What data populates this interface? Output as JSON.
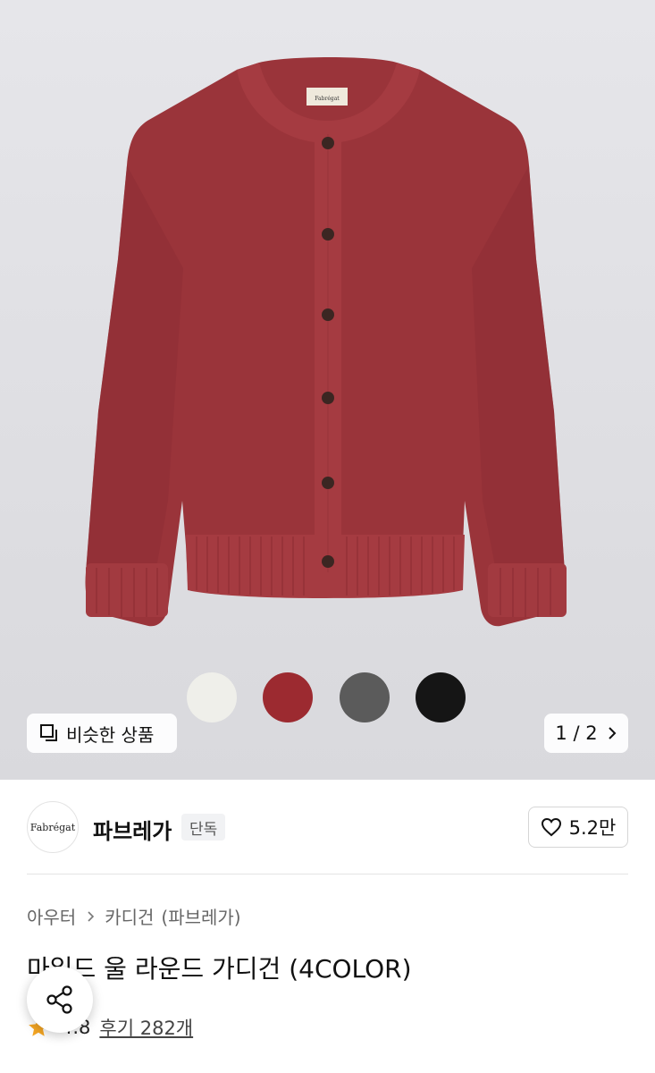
{
  "gallery": {
    "similar_label": "비슷한 상품",
    "page_indicator": "1 / 2",
    "swatches": [
      {
        "name": "cream",
        "color": "#efefea"
      },
      {
        "name": "red",
        "color": "#9c2a30"
      },
      {
        "name": "gray",
        "color": "#5b5b5b"
      },
      {
        "name": "black",
        "color": "#151515"
      }
    ],
    "garment_label": "Fabrégat",
    "product_color": "#9a343a"
  },
  "brand": {
    "logo_text": "Fabrégat",
    "name": "파브레가",
    "badge": "단독",
    "likes": "5.2만"
  },
  "breadcrumb": {
    "level1": "아우터",
    "level2": "카디건",
    "brand_note": "(파브레가)"
  },
  "product": {
    "title": "마일드 울 라운드 가디건 (4COLOR)",
    "rating": "4.8",
    "reviews": "후기 282개"
  },
  "colors": {
    "star": "#f5a623",
    "hero_bg": "#e0e0e4"
  }
}
